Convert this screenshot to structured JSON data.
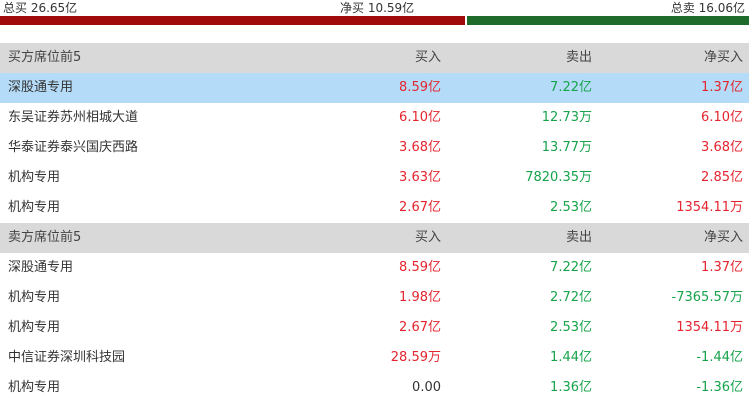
{
  "summary": {
    "total_buy": "总买 26.65亿",
    "net_buy": "净买 10.59亿",
    "total_sell": "总卖 16.06亿"
  },
  "buy_section": {
    "header": {
      "name": "买方席位前5",
      "buy": "买入",
      "sell": "卖出",
      "net": "净买入"
    },
    "rows": [
      {
        "name": "深股通专用",
        "buy": "8.59亿",
        "sell": "7.22亿",
        "net": "1.37亿",
        "net_color": "red"
      },
      {
        "name": "东吴证券苏州相城大道",
        "buy": "6.10亿",
        "sell": "12.73万",
        "net": "6.10亿",
        "net_color": "red"
      },
      {
        "name": "华泰证券泰兴国庆西路",
        "buy": "3.68亿",
        "sell": "13.77万",
        "net": "3.68亿",
        "net_color": "red"
      },
      {
        "name": "机构专用",
        "buy": "3.63亿",
        "sell": "7820.35万",
        "net": "2.85亿",
        "net_color": "red"
      },
      {
        "name": "机构专用",
        "buy": "2.67亿",
        "sell": "2.53亿",
        "net": "1354.11万",
        "net_color": "red"
      }
    ]
  },
  "sell_section": {
    "header": {
      "name": "卖方席位前5",
      "buy": "买入",
      "sell": "卖出",
      "net": "净买入"
    },
    "rows": [
      {
        "name": "深股通专用",
        "buy": "8.59亿",
        "sell": "7.22亿",
        "net": "1.37亿",
        "net_color": "red"
      },
      {
        "name": "机构专用",
        "buy": "1.98亿",
        "sell": "2.72亿",
        "net": "-7365.57万",
        "net_color": "green"
      },
      {
        "name": "机构专用",
        "buy": "2.67亿",
        "sell": "2.53亿",
        "net": "1354.11万",
        "net_color": "red"
      },
      {
        "name": "中信证券深圳科技园",
        "buy": "28.59万",
        "sell": "1.44亿",
        "net": "-1.44亿",
        "net_color": "green"
      },
      {
        "name": "机构专用",
        "buy": "0.00",
        "sell": "1.36亿",
        "net": "-1.36亿",
        "net_color": "green"
      }
    ]
  },
  "colors": {
    "buy_bar": "#a10a0a",
    "sell_bar": "#1e6b2c",
    "highlight": "#b4dcf8",
    "up": "#e4252f",
    "down": "#16a34a"
  }
}
